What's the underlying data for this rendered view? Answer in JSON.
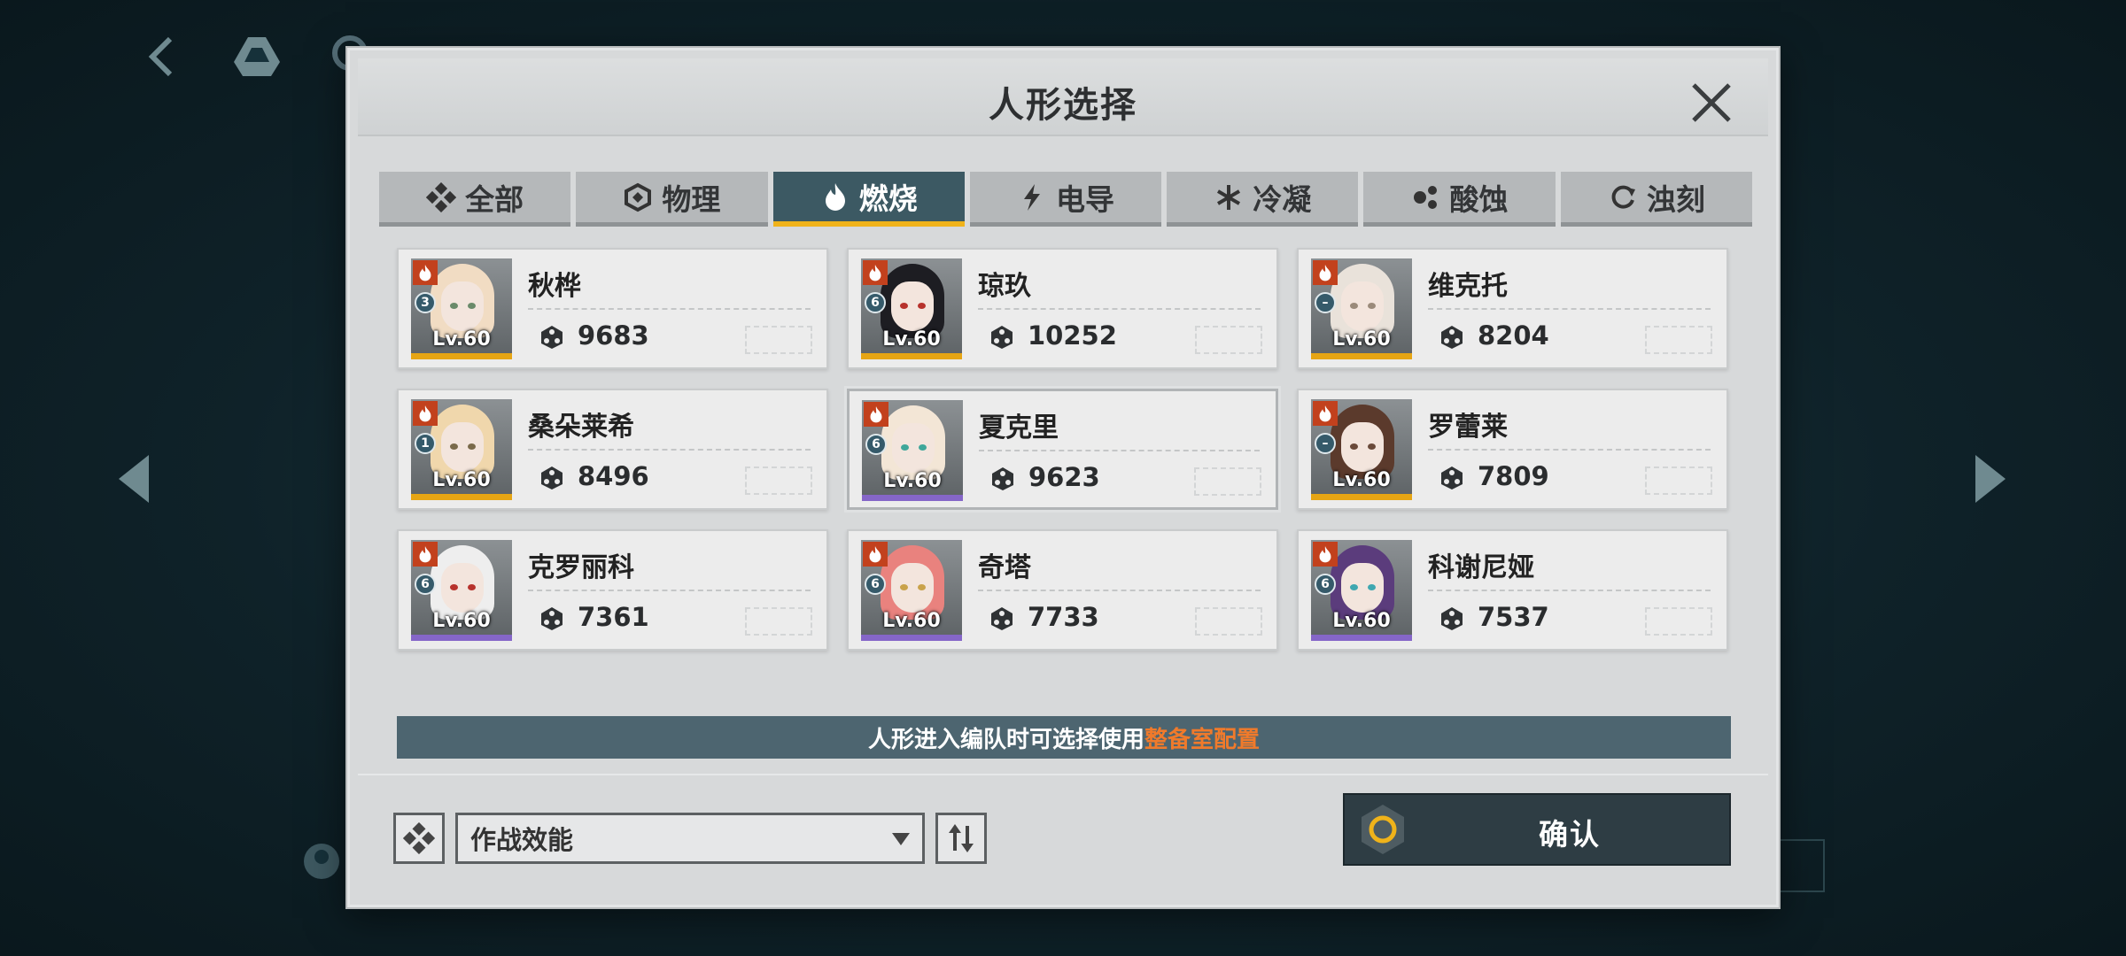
{
  "dialog": {
    "title": "人形选择"
  },
  "tabs": [
    {
      "label": "全部",
      "icon": "all-icon"
    },
    {
      "label": "物理",
      "icon": "physical-icon"
    },
    {
      "label": "燃烧",
      "icon": "burn-icon",
      "active": true
    },
    {
      "label": "电导",
      "icon": "electric-icon"
    },
    {
      "label": "冷凝",
      "icon": "freeze-icon"
    },
    {
      "label": "酸蚀",
      "icon": "acid-icon"
    },
    {
      "label": "浊刻",
      "icon": "corrode-icon"
    }
  ],
  "characters": [
    {
      "name": "秋桦",
      "level": "Lv.60",
      "rank": "3",
      "power": "9683",
      "rarity_color": "#e6a514",
      "hair": "#f1dcc3"
    },
    {
      "name": "琼玖",
      "level": "Lv.60",
      "rank": "6",
      "power": "10252",
      "rarity_color": "#e6a514",
      "hair": "#1d1d22"
    },
    {
      "name": "维克托",
      "level": "Lv.60",
      "rank": "–",
      "power": "8204",
      "rarity_color": "#e6a514",
      "hair": "#e9e2da"
    },
    {
      "name": "桑朵莱希",
      "level": "Lv.60",
      "rank": "1",
      "power": "8496",
      "rarity_color": "#e6a514",
      "hair": "#f0d7ac"
    },
    {
      "name": "夏克里",
      "level": "Lv.60",
      "rank": "6",
      "power": "9623",
      "rarity_color": "#8566c8",
      "hair": "#f3e6d6"
    },
    {
      "name": "罗蕾莱",
      "level": "Lv.60",
      "rank": "–",
      "power": "7809",
      "rarity_color": "#e6a514",
      "hair": "#5b3a2c"
    },
    {
      "name": "克罗丽科",
      "level": "Lv.60",
      "rank": "6",
      "power": "7361",
      "rarity_color": "#8566c8",
      "hair": "#eeeeee"
    },
    {
      "name": "奇塔",
      "level": "Lv.60",
      "rank": "6",
      "power": "7733",
      "rarity_color": "#8566c8",
      "hair": "#e9827e"
    },
    {
      "name": "科谢尼娅",
      "level": "Lv.60",
      "rank": "6",
      "power": "7537",
      "rarity_color": "#8566c8",
      "hair": "#5b3c7c"
    }
  ],
  "banner": {
    "text": "人形进入编队时可选择使用",
    "highlight": "整备室配置"
  },
  "sort": {
    "selected": "作战效能"
  },
  "confirm": {
    "label": "确认"
  },
  "colors": {
    "accent": "#f0b31a",
    "tab_active": "#3c5963",
    "banner": "#4d6570",
    "highlight": "#f07a2b"
  }
}
